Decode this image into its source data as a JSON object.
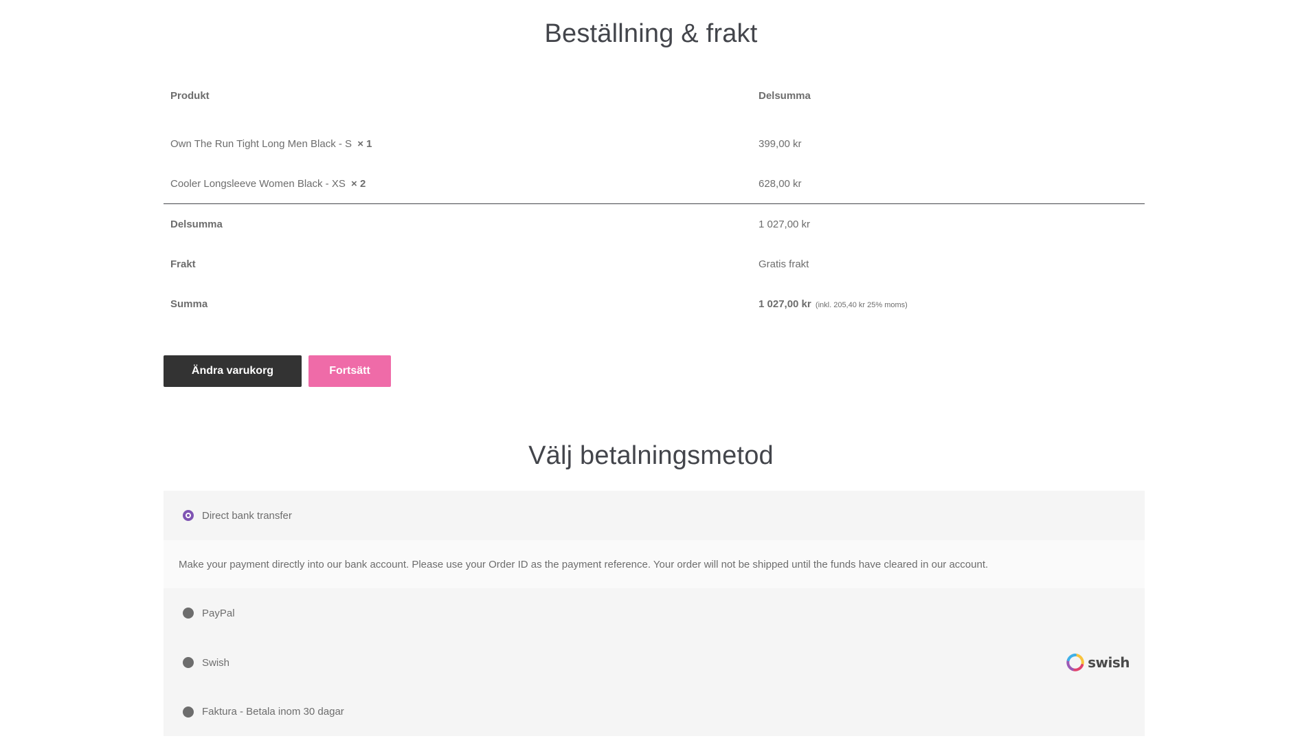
{
  "order_section": {
    "title": "Beställning & frakt",
    "columns": {
      "product": "Produkt",
      "subtotal": "Delsumma"
    },
    "items": [
      {
        "name": "Own The Run Tight Long Men Black - S",
        "qty": "× 1",
        "subtotal": "399,00 kr"
      },
      {
        "name": "Cooler Longsleeve Women Black - XS",
        "qty": "× 2",
        "subtotal": "628,00 kr"
      }
    ],
    "totals": {
      "subtotal_label": "Delsumma",
      "subtotal_value": "1 027,00 kr",
      "shipping_label": "Frakt",
      "shipping_value": "Gratis frakt",
      "total_label": "Summa",
      "total_value": "1 027,00 kr",
      "total_tax_note": "(inkl. 205,40 kr 25% moms)"
    }
  },
  "buttons": {
    "edit_cart": "Ändra varukorg",
    "continue": "Fortsätt"
  },
  "payment_section": {
    "title": "Välj betalningsmetod",
    "methods": [
      {
        "label": "Direct bank transfer",
        "selected": true
      },
      {
        "label": "PayPal",
        "selected": false
      },
      {
        "label": "Swish",
        "selected": false,
        "logo_text": "swish"
      },
      {
        "label": "Faktura - Betala inom 30 dagar",
        "selected": false
      }
    ],
    "bank_transfer_description": "Make your payment directly into our bank account. Please use your Order ID as the payment reference. Your order will not be shipped until the funds have cleared in our account."
  },
  "colors": {
    "dark_button": "#333333",
    "pink_button": "#ef6ba8",
    "radio_selected": "#7f54b3",
    "payment_bg": "#f5f5f5"
  }
}
